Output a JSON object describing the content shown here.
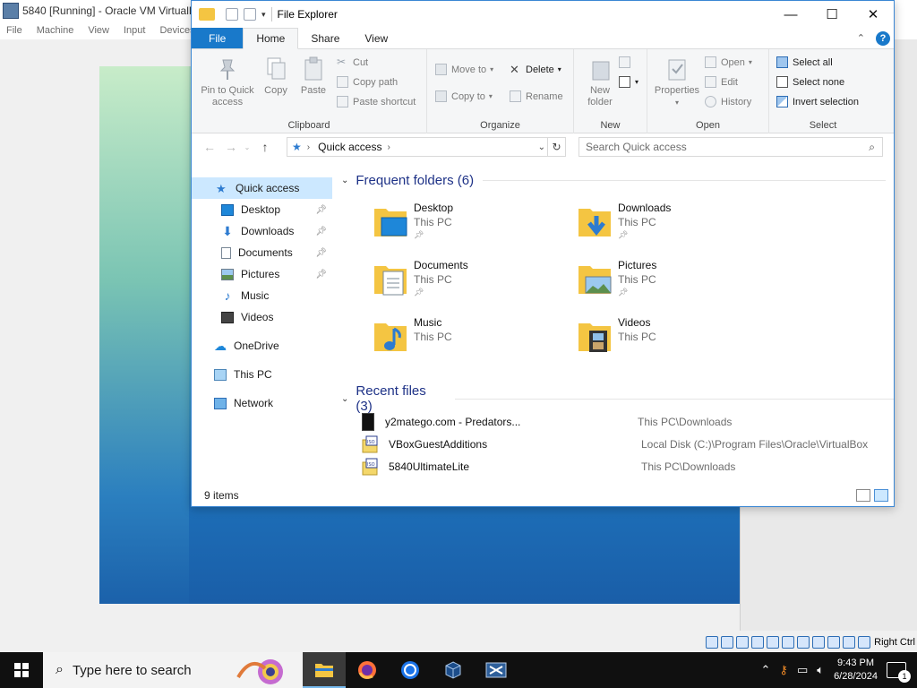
{
  "vbox": {
    "title": "5840 [Running] - Oracle VM VirtualB",
    "menu": [
      "File",
      "Machine",
      "View",
      "Input",
      "Devices"
    ],
    "status_text": "Right Ctrl"
  },
  "explorer": {
    "title": "File Explorer",
    "tabs": {
      "file": "File",
      "home": "Home",
      "share": "Share",
      "view": "View"
    },
    "help": "?",
    "ribbon": {
      "clipboard": {
        "label": "Clipboard",
        "pin": "Pin to Quick access",
        "copy": "Copy",
        "paste": "Paste",
        "cut": "Cut",
        "copy_path": "Copy path",
        "paste_shortcut": "Paste shortcut"
      },
      "organize": {
        "label": "Organize",
        "move_to": "Move to",
        "copy_to": "Copy to",
        "delete": "Delete",
        "rename": "Rename"
      },
      "new": {
        "label": "New",
        "new_folder": "New folder"
      },
      "open": {
        "label": "Open",
        "properties": "Properties",
        "open": "Open",
        "edit": "Edit",
        "history": "History"
      },
      "select": {
        "label": "Select",
        "select_all": "Select all",
        "select_none": "Select none",
        "invert": "Invert selection"
      }
    },
    "address": {
      "crumb": "Quick access"
    },
    "search": {
      "placeholder": "Search Quick access"
    },
    "nav": {
      "quick_access": "Quick access",
      "desktop": "Desktop",
      "downloads": "Downloads",
      "documents": "Documents",
      "pictures": "Pictures",
      "music": "Music",
      "videos": "Videos",
      "onedrive": "OneDrive",
      "this_pc": "This PC",
      "network": "Network"
    },
    "frequent": {
      "header": "Frequent folders (6)",
      "folders": [
        {
          "name": "Desktop",
          "location": "This PC",
          "pinned": true
        },
        {
          "name": "Downloads",
          "location": "This PC",
          "pinned": true
        },
        {
          "name": "Documents",
          "location": "This PC",
          "pinned": true
        },
        {
          "name": "Pictures",
          "location": "This PC",
          "pinned": true
        },
        {
          "name": "Music",
          "location": "This PC",
          "pinned": false
        },
        {
          "name": "Videos",
          "location": "This PC",
          "pinned": false
        }
      ]
    },
    "recent": {
      "header": "Recent files (3)",
      "files": [
        {
          "name": "y2matego.com - Predators...",
          "path": "This PC\\Downloads"
        },
        {
          "name": "VBoxGuestAdditions",
          "path": "Local Disk (C:)\\Program Files\\Oracle\\VirtualBox"
        },
        {
          "name": "5840UltimateLite",
          "path": "This PC\\Downloads"
        }
      ]
    },
    "status": "9 items"
  },
  "taskbar": {
    "search_placeholder": "Type here to search",
    "time": "9:43 PM",
    "date": "6/28/2024",
    "notifications": "1"
  },
  "colors": {
    "accent": "#1979ca",
    "selection": "#cce8ff",
    "header_blue": "#1e3287",
    "folder": "#f4c542"
  }
}
